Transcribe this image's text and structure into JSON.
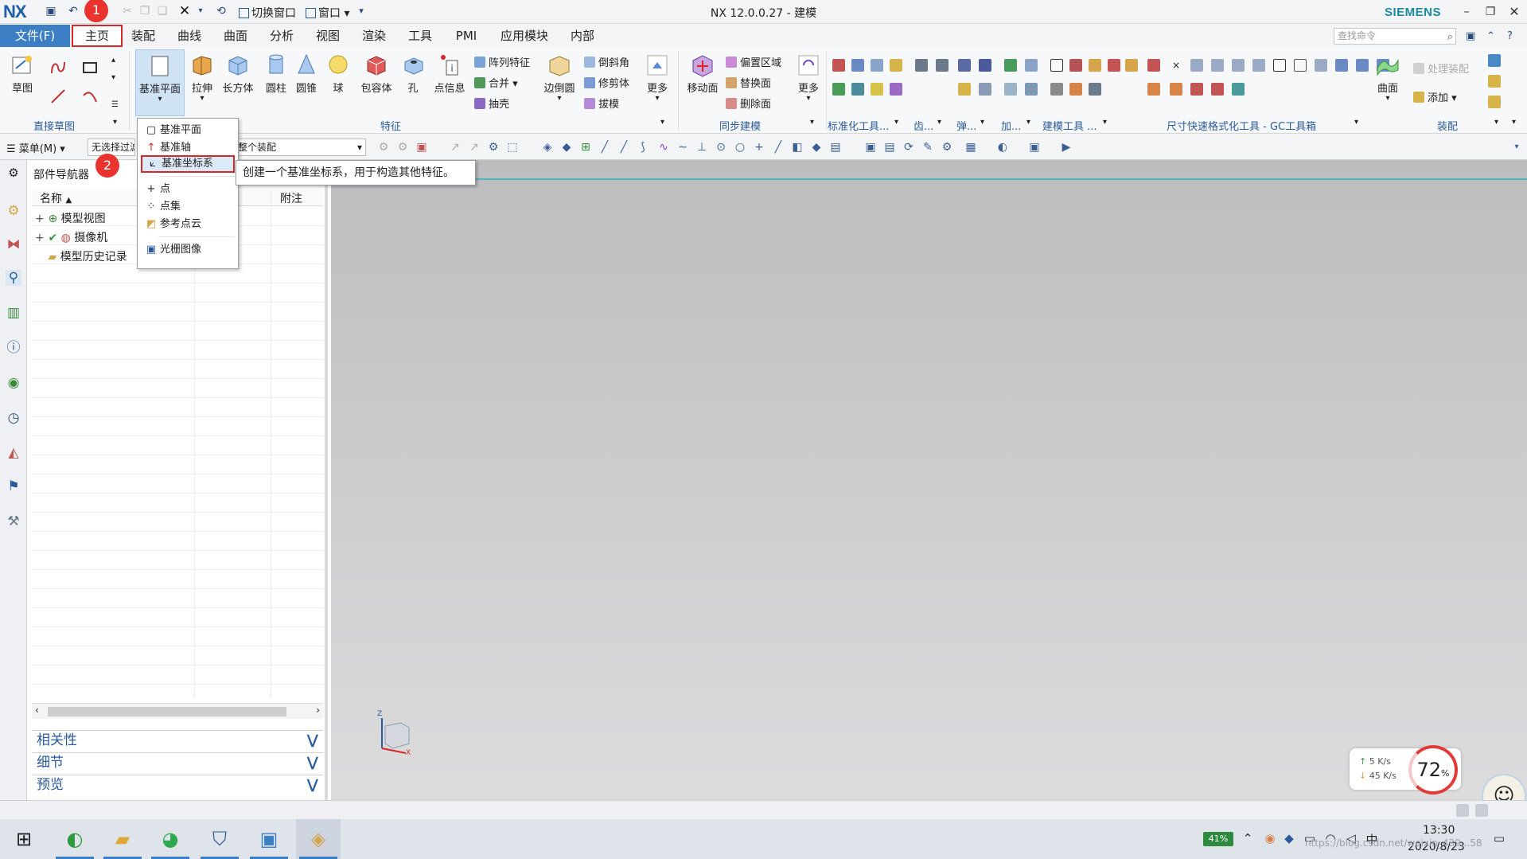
{
  "titlebar": {
    "logo": "NX",
    "title": "NX 12.0.0.27 - 建模",
    "brand": "SIEMENS",
    "switch_window": "切换窗口",
    "window_menu": "窗口"
  },
  "menubar": {
    "file": "文件(F)",
    "tabs": [
      "主页",
      "装配",
      "曲线",
      "曲面",
      "分析",
      "视图",
      "渲染",
      "工具",
      "PMI",
      "应用模块",
      "内部"
    ],
    "search_placeholder": "查找命令"
  },
  "ribbon": {
    "sketch": "草图",
    "direct_sketch_group": "直接草图",
    "datum_plane": "基准平面",
    "extrude": "拉伸",
    "block": "长方体",
    "cylinder": "圆柱",
    "cone": "圆锥",
    "sphere": "球",
    "wrap": "包容体",
    "hole": "孔",
    "point_info": "点信息",
    "pattern_feature": "阵列特征",
    "unite": "合并",
    "shell": "抽壳",
    "edge_blend": "边倒圆",
    "chamfer": "倒斜角",
    "trim_body": "修剪体",
    "draft": "拔模",
    "more": "更多",
    "feature_group": "特征",
    "move_face": "移动面",
    "offset_region": "偏置区域",
    "replace_face": "替换面",
    "delete_face": "删除面",
    "sync_group": "同步建模",
    "more2": "更多",
    "std_tools_group": "标准化工具...",
    "gear_group": "齿...",
    "spring_group": "弹...",
    "add_group": "加...",
    "modeling_tools_group": "建模工具 ...",
    "dim_group": "尺寸快速格式化工具 - GC工具箱",
    "surface": "曲面",
    "process_assembly": "处理装配",
    "add": "添加",
    "assembly_group": "装配"
  },
  "selbar": {
    "menu": "菜单(M)",
    "filter": "无选择过滤器",
    "scope": "整个装配"
  },
  "dropdown": {
    "items": [
      "基准平面",
      "基准轴",
      "基准坐标系",
      "点",
      "点集",
      "参考点云",
      "光栅图像"
    ]
  },
  "tooltip": "创建一个基准坐标系，用于构造其他特征。",
  "markers": [
    "1",
    "2"
  ],
  "navigator": {
    "title": "部件导航器",
    "col_name": "名称",
    "col_note": "附注",
    "rows": [
      "模型视图",
      "摄像机",
      "模型历史记录"
    ],
    "sections": [
      "相关性",
      "细节",
      "预览"
    ]
  },
  "triad": {
    "z": "Z",
    "x": "X"
  },
  "net_widget": {
    "up": "5  K/s",
    "down": "45  K/s"
  },
  "cpu": {
    "value": "72",
    "unit": "%"
  },
  "taskbar": {
    "battery": "41%",
    "time": "13:30",
    "date": "2020/8/23",
    "watermark": "https://blog.csdn.net/weixin_439...58"
  }
}
